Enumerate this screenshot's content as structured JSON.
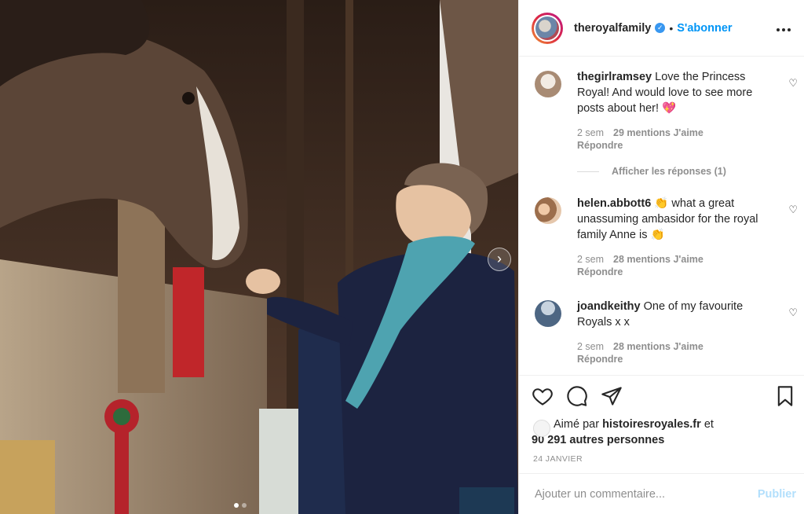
{
  "post": {
    "account": "theroyalfamily",
    "verified_icon": "verified-badge-icon",
    "separator": "•",
    "follow_label": "S'abonner",
    "more_label": "•••",
    "next_label": "›"
  },
  "comments": [
    {
      "user": "thegirlramsey",
      "text": "Love the Princess Royal! And would love to see more posts about her! 💖",
      "time": "2 sem",
      "likes": "29 mentions J'aime",
      "reply": "Répondre",
      "avatar_color": "#c9b7a6"
    },
    {
      "user": "helen.abbott6",
      "text": "👏 what a great unassuming ambasidor for the royal family Anne is 👏",
      "time": "2 sem",
      "likes": "28 mentions J'aime",
      "reply": "Répondre",
      "avatar_color": "#b68a6e"
    },
    {
      "user": "joandkeithy",
      "text": "One of my favourite Royals x x",
      "time": "2 sem",
      "likes": "28 mentions J'aime",
      "reply": "Répondre",
      "avatar_color": "#5b7a99"
    }
  ],
  "view_replies": "Afficher les réponses (1)",
  "liked_by": {
    "prefix": "Aimé par",
    "user": "histoiresroyales.fr",
    "and": "et",
    "others": "90 291 autres personnes"
  },
  "date": "24 JANVIER",
  "add_comment": {
    "placeholder": "Ajouter un commentaire...",
    "publish": "Publier"
  },
  "colors": {
    "accent": "#0095f6",
    "muted": "#8e8e8e",
    "publish_disabled": "#b2dffc"
  }
}
